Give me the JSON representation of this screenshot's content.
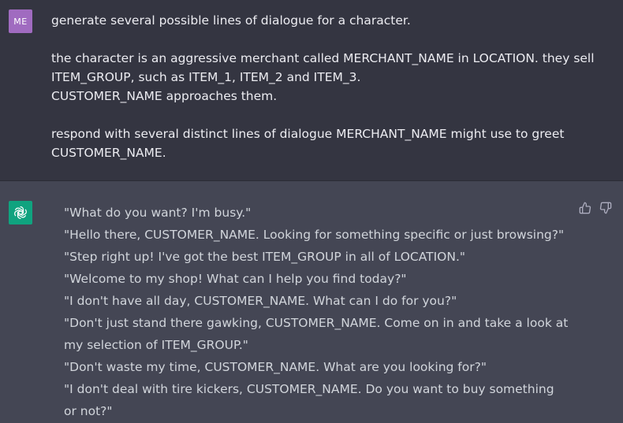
{
  "user": {
    "avatar_initials": "ME",
    "paragraphs": [
      "generate several possible lines of dialogue for a character.",
      "the character is an aggressive merchant called MERCHANT_NAME in LOCATION. they sell ITEM_GROUP, such as ITEM_1, ITEM_2 and ITEM_3.\nCUSTOMER_NAME approaches them.",
      "respond with several distinct lines of dialogue MERCHANT_NAME might use to greet CUSTOMER_NAME."
    ]
  },
  "assistant": {
    "avatar_icon": "openai-logo-icon",
    "lines": [
      "\"What do you want? I'm busy.\"",
      "\"Hello there, CUSTOMER_NAME. Looking for something specific or just browsing?\"",
      "\"Step right up! I've got the best ITEM_GROUP in all of LOCATION.\"",
      "\"Welcome to my shop! What can I help you find today?\"",
      "\"I don't have all day, CUSTOMER_NAME. What can I do for you?\"",
      "\"Don't just stand there gawking, CUSTOMER_NAME. Come on in and take a look at my selection of ITEM_GROUP.\"",
      "\"Don't waste my time, CUSTOMER_NAME. What are you looking for?\"",
      "\"I don't deal with tire kickers, CUSTOMER_NAME. Do you want to buy something or not?\""
    ],
    "feedback": {
      "thumbs_up_icon": "thumbs-up-icon",
      "thumbs_down_icon": "thumbs-down-icon"
    }
  },
  "colors": {
    "user_bg": "#343541",
    "assistant_bg": "#444654",
    "user_avatar": "#a06bc0",
    "bot_avatar": "#10a37f"
  }
}
